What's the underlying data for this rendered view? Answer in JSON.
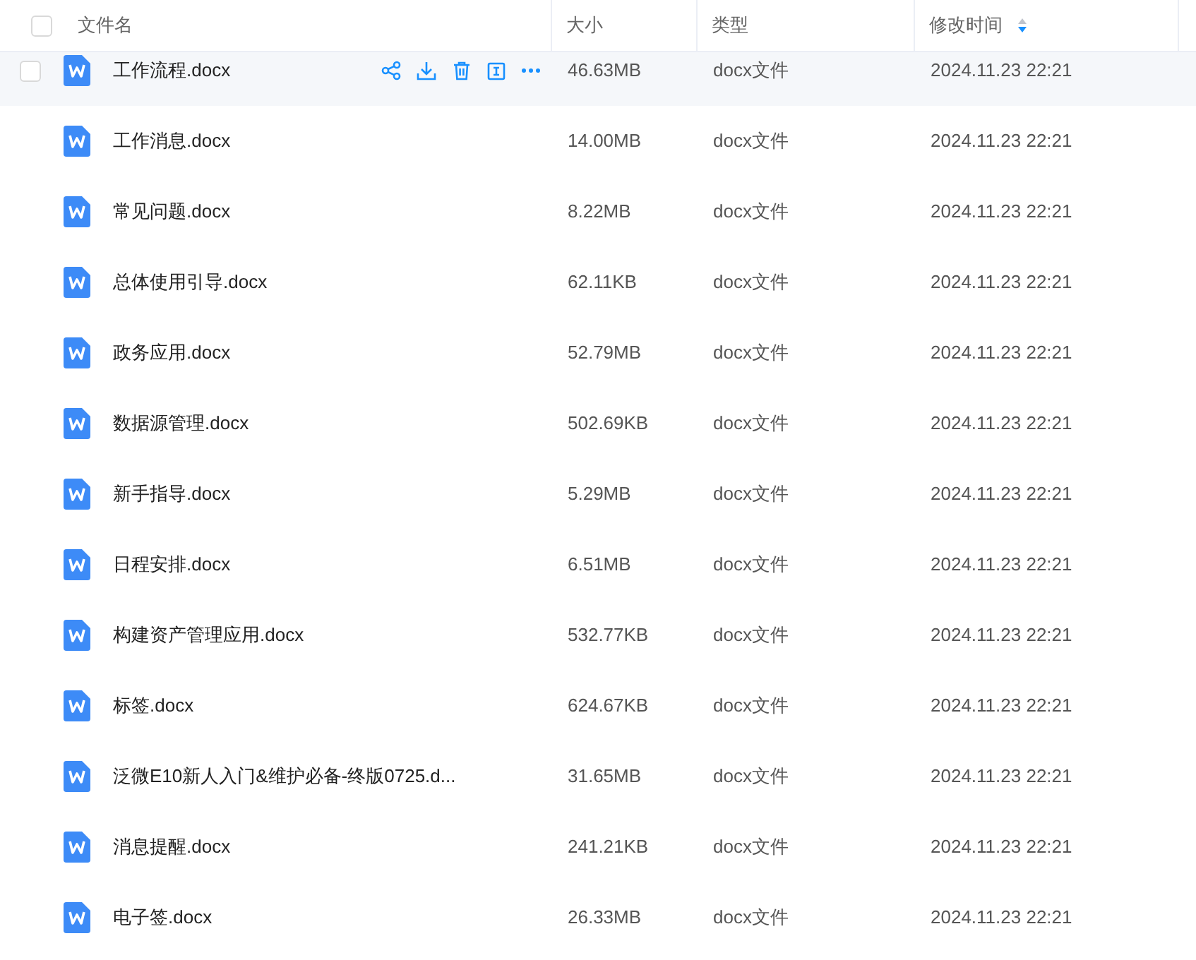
{
  "select_all": {
    "checked": false
  },
  "columns": [
    {
      "label": "文件名"
    },
    {
      "label": "大小"
    },
    {
      "label": "类型"
    },
    {
      "label": "修改时间",
      "sorted_descending": true
    }
  ],
  "rows": [
    {
      "name": "工作流程.docx",
      "size": "46.63MB",
      "type": "docx文件",
      "modified": "2024.11.23 22:21",
      "hovered": true
    },
    {
      "name": "工作消息.docx",
      "size": "14.00MB",
      "type": "docx文件",
      "modified": "2024.11.23 22:21",
      "hovered": false
    },
    {
      "name": "常见问题.docx",
      "size": "8.22MB",
      "type": "docx文件",
      "modified": "2024.11.23 22:21",
      "hovered": false
    },
    {
      "name": "总体使用引导.docx",
      "size": "62.11KB",
      "type": "docx文件",
      "modified": "2024.11.23 22:21",
      "hovered": false
    },
    {
      "name": "政务应用.docx",
      "size": "52.79MB",
      "type": "docx文件",
      "modified": "2024.11.23 22:21",
      "hovered": false
    },
    {
      "name": "数据源管理.docx",
      "size": "502.69KB",
      "type": "docx文件",
      "modified": "2024.11.23 22:21",
      "hovered": false
    },
    {
      "name": "新手指导.docx",
      "size": "5.29MB",
      "type": "docx文件",
      "modified": "2024.11.23 22:21",
      "hovered": false
    },
    {
      "name": "日程安排.docx",
      "size": "6.51MB",
      "type": "docx文件",
      "modified": "2024.11.23 22:21",
      "hovered": false
    },
    {
      "name": "构建资产管理应用.docx",
      "size": "532.77KB",
      "type": "docx文件",
      "modified": "2024.11.23 22:21",
      "hovered": false
    },
    {
      "name": "标签.docx",
      "size": "624.67KB",
      "type": "docx文件",
      "modified": "2024.11.23 22:21",
      "hovered": false
    },
    {
      "name": "泛微E10新人入门&维护必备-终版0725.d...",
      "size": "31.65MB",
      "type": "docx文件",
      "modified": "2024.11.23 22:21",
      "hovered": false
    },
    {
      "name": "消息提醒.docx",
      "size": "241.21KB",
      "type": "docx文件",
      "modified": "2024.11.23 22:21",
      "hovered": false
    },
    {
      "name": "电子签.docx",
      "size": "26.33MB",
      "type": "docx文件",
      "modified": "2024.11.23 22:21",
      "hovered": false
    }
  ]
}
